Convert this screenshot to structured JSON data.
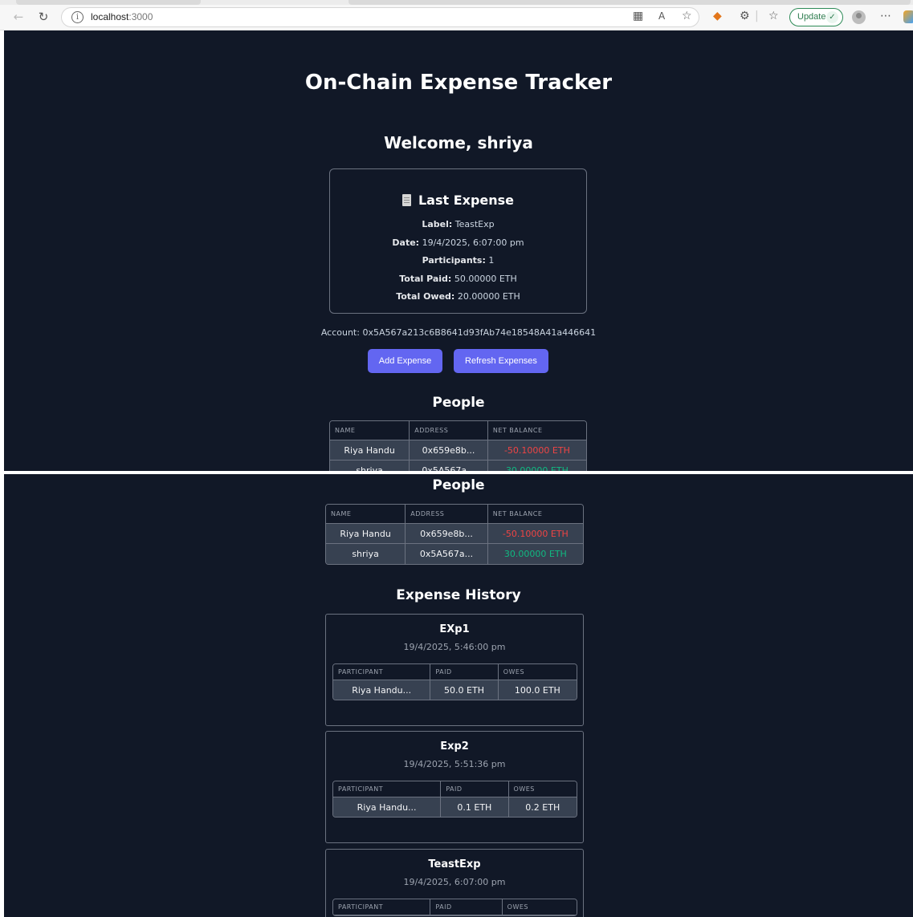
{
  "browser": {
    "url_host": "localhost",
    "url_port": ":3000",
    "update_label": "Update"
  },
  "app": {
    "title": "On-Chain Expense Tracker",
    "welcome": "Welcome, shriya",
    "last_expense": {
      "title": "Last Expense",
      "label_key": "Label:",
      "label_value": "TeastExp",
      "date_key": "Date:",
      "date_value": "19/4/2025, 6:07:00 pm",
      "participants_key": "Participants:",
      "participants_value": "1",
      "total_paid_key": "Total Paid:",
      "total_paid_value": "50.00000 ETH",
      "total_owed_key": "Total Owed:",
      "total_owed_value": "20.00000 ETH"
    },
    "account": "Account: 0x5A567a213c6B8641d93fAb74e18548A41a446641",
    "add_expense_label": "Add Expense",
    "refresh_expenses_label": "Refresh Expenses",
    "people_title": "People",
    "people_headers": [
      "NAME",
      "ADDRESS",
      "NET BALANCE"
    ],
    "people": [
      {
        "name": "Riya Handu",
        "address": "0x659e8b...",
        "balance": "-50.10000 ETH"
      },
      {
        "name": "shriya",
        "address": "0x5A567a...",
        "balance": "30.00000 ETH"
      }
    ],
    "history_title": "Expense History",
    "history_headers": [
      "PARTICIPANT",
      "PAID",
      "OWES"
    ],
    "expenses": [
      {
        "label": "EXp1",
        "date": "19/4/2025, 5:46:00 pm",
        "rows": [
          {
            "participant": "Riya Handu...",
            "paid": "50.0 ETH",
            "owes": "100.0 ETH"
          }
        ]
      },
      {
        "label": "Exp2",
        "date": "19/4/2025, 5:51:36 pm",
        "rows": [
          {
            "participant": "Riya Handu...",
            "paid": "0.1 ETH",
            "owes": "0.2 ETH"
          }
        ]
      },
      {
        "label": "TeastExp",
        "date": "19/4/2025, 6:07:00 pm",
        "rows": []
      }
    ]
  }
}
